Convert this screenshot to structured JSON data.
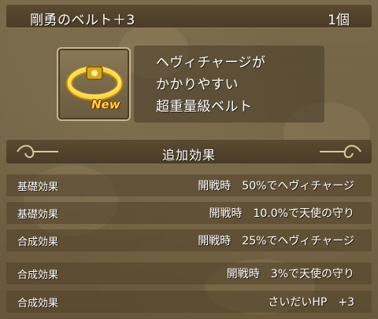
{
  "item": {
    "name": "剛勇のベルト＋3",
    "count": "1個",
    "badge": "New",
    "icon": "gold-belt-icon",
    "description": [
      "ヘヴィチャージが",
      "かかりやすい",
      "超重量級ベルト"
    ]
  },
  "effects": {
    "title": "追加効果",
    "rows": [
      {
        "type": "基礎効果",
        "value": "開戦時　50%でヘヴィチャージ"
      },
      {
        "type": "基礎効果",
        "value": "開戦時　10.0%で天使の守り"
      },
      {
        "type": "合成効果",
        "value": "開戦時　25%でヘヴィチャージ"
      },
      {
        "type": "合成効果",
        "value": "開戦時　3%で天使の守り"
      },
      {
        "type": "合成効果",
        "value": "さいだいHP　+3"
      }
    ]
  },
  "colors": {
    "text": "#ffffff",
    "badge": "#ffd23a",
    "frame": "#c7b68c"
  }
}
